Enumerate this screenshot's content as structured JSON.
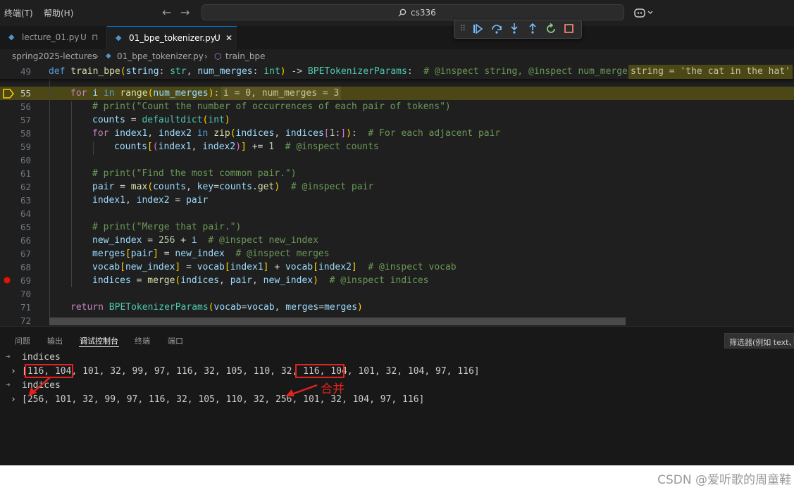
{
  "menu": {
    "terminal": "终端(T)",
    "help": "帮助(H)"
  },
  "nav": {
    "back": "←",
    "forward": "→"
  },
  "search": {
    "text": "cs336"
  },
  "tabs": [
    {
      "name": "lecture_01.py",
      "status": "U",
      "pin": "⊓"
    },
    {
      "name": "01_bpe_tokenizer.py",
      "status": "U",
      "close": "✕"
    }
  ],
  "breadcrumb": {
    "folder": "spring2025-lectures",
    "file": "01_bpe_tokenizer.py",
    "symbol": "train_bpe"
  },
  "editor": {
    "sticky_line_no": "49",
    "line_numbers": [
      "55",
      "56",
      "57",
      "58",
      "59",
      "60",
      "61",
      "62",
      "63",
      "64",
      "65",
      "66",
      "67",
      "68",
      "69",
      "70",
      "71",
      "72"
    ],
    "inline_values": {
      "sticky": "string = 'the cat in the hat'",
      "line55": "i = 0, num_merges = 3"
    }
  },
  "panel": {
    "tabs": [
      "问题",
      "输出",
      "调试控制台",
      "终端",
      "端口"
    ],
    "active_tab": "调试控制台",
    "filter_placeholder": "筛选器(例如 text、!exclude)",
    "entries": [
      {
        "expr": "indices",
        "value": "[116, 104, 101, 32, 99, 97, 116, 32, 105, 110, 32, 116, 104, 101, 32, 104, 97, 116]"
      },
      {
        "expr": "indices",
        "value": "[256, 101, 32, 99, 97, 116, 32, 105, 110, 32, 256, 101, 32, 104, 97, 116]"
      }
    ],
    "annotation": "合并"
  },
  "watermark": "CSDN @爱听歌的周童鞋",
  "colors": {
    "accent": "#0078d4",
    "annotation": "#e0231f",
    "current_line": "#4b4716"
  }
}
